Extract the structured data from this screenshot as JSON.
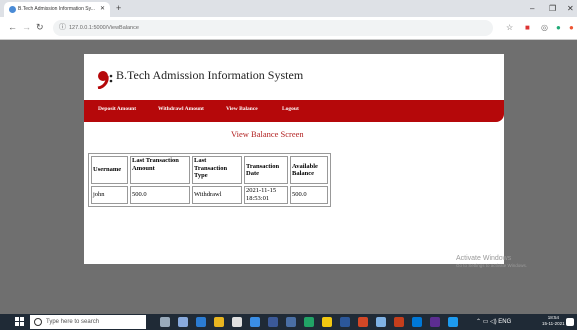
{
  "browser": {
    "tab_title": "B.Tech Admission Information Sy...",
    "url": "127.0.0.1:5000/ViewBalance"
  },
  "app": {
    "title": "B.Tech Admission Information System",
    "menu": [
      "Deposit Amount",
      "Withdrawl Amount",
      "View Balance",
      "Logout"
    ],
    "screen_heading": "View Balance Screen"
  },
  "table": {
    "headers": [
      "Username",
      "Last Transaction Amount",
      "Last Transaction Type",
      "Transaction Date",
      "Available Balance"
    ],
    "rows": [
      [
        "john",
        "500.0",
        "Withdrawl",
        "2021-11-15 18:53:01",
        "500.0"
      ]
    ]
  },
  "watermark": {
    "line1": "Activate Windows",
    "line2": "Go to Settings to activate Windows."
  },
  "taskbar": {
    "search_placeholder": "Type here to search",
    "time": "18:54",
    "date": "15-11-2021"
  },
  "colors": {
    "menu_bar": "#b5080a",
    "heading": "#b11e1e",
    "viewport": "#6f6f6f"
  }
}
